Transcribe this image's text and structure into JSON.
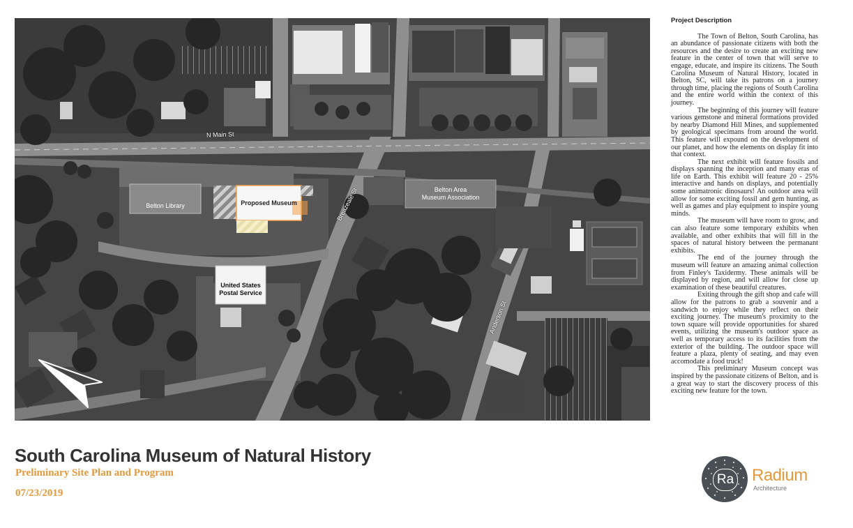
{
  "map": {
    "street_labels": {
      "n_main": "N Main St",
      "breazeale": "Breazeale St",
      "anderson": "Anderson St"
    },
    "building_labels": {
      "library": "Belton Library",
      "proposed": "Proposed Museum",
      "museum_assoc": [
        "Belton Area",
        "Museum Association"
      ],
      "post_office": [
        "United States",
        "Postal Service"
      ]
    },
    "colors": {
      "highlight": "#f5a04a",
      "road": "#9a9a9a",
      "trees": "#2a2a2a"
    },
    "icons": [
      "north-arrow-icon"
    ]
  },
  "description": {
    "title": "Project Description",
    "paragraphs": [
      "The Town of Belton, South Carolina, has an abundance of passionate citizens with both the resources and the desire to create an exciting new feature in the center of town that will serve to engage, educate, and inspire its citizens. The South Carolina Museum of Natural History, located in Belton, SC, will take its patrons on a journey through time, placing the regions of South Carolina and the entire world within the context of this journey.",
      "The beginning of this journey will feature various gemstone and mineral formations provided by nearby Diamond Hill Mines, and supplemented by geological specimans from around the world. This feature will expound on the development of our planet, and how the elements on display fit into that context.",
      "The next exhibit will feature fossils and displays spanning the inception and many eras of life on Earth. This exhibit will feature 20 - 25% interactive and hands on displays, and potentially some animatronic dinosaurs! An outdoor area will allow for some exciting fossil and gem hunting, as well as games and play equipment to inspire young minds.",
      "The museum will have room to grow, and can also feature some temporary exhibits when available, and other exhibits that will fill in the spaces of natural history between the permanant exhibits.",
      "The end of the journey through the museum will feature an amazing animal collection from Finley's Taxidermy. These animals will be displayed by region, and will allow for close up examination of these beautiful creatures.",
      "Exiting through the gift shop and cafe will allow for the patrons to grab a souvenir and a sandwich to enjoy while they reflect on their exciting journey. The museum's proximity to the town square will provide opportunities for shared events, utilizing the museum's outdoor space as well as temporary access to its facilities from the exterior of the building. The outdoor space will feature a plaza, plenty of seating, and may even accomodate a food truck!",
      "This preliminary Museum concept was inspired by the passionate citizens of Belton, and is a great way to start the discovery process of this exciting new feature for the town."
    ]
  },
  "footer": {
    "title": "South Carolina Museum of Natural History",
    "subtitle": "Preliminary Site Plan and Program",
    "date": "07/23/2019"
  },
  "logo": {
    "mark": "Ra",
    "name": "Radium",
    "tagline": "Architecture",
    "accent": "#e49a3c",
    "circle": "#4a4f56"
  }
}
